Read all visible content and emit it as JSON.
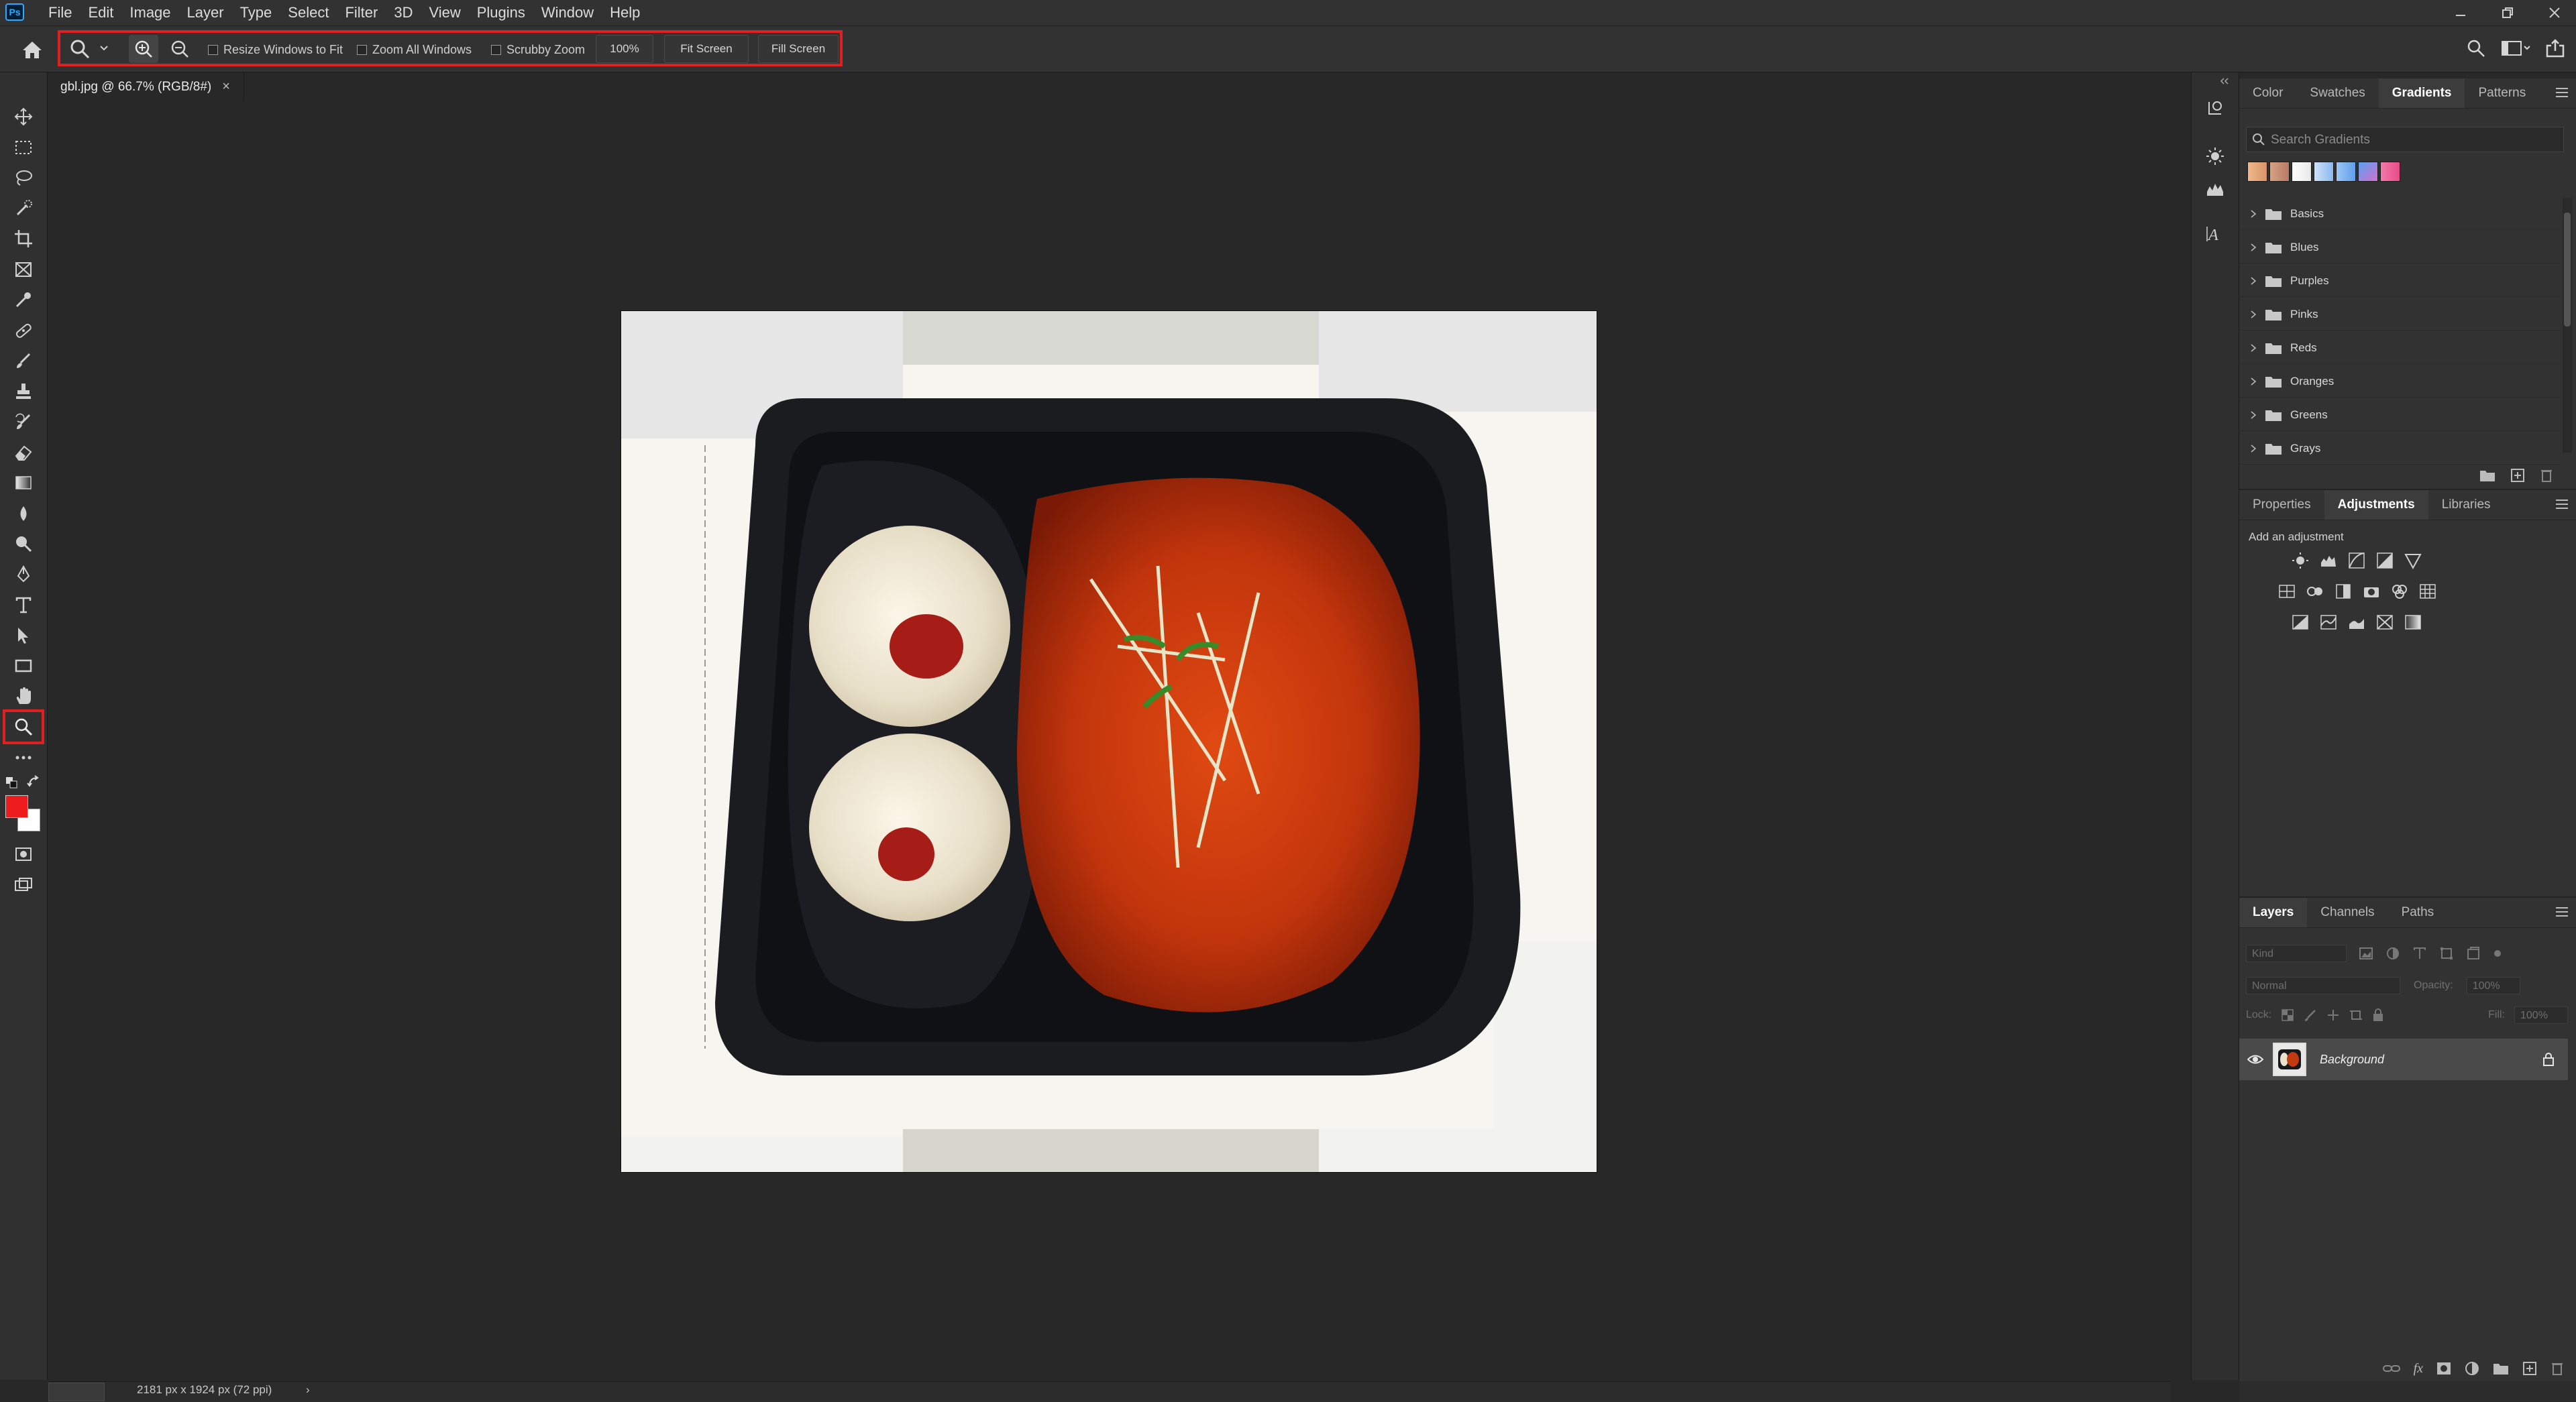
{
  "app": {
    "logo_text": "Ps"
  },
  "menu": [
    "File",
    "Edit",
    "Image",
    "Layer",
    "Type",
    "Select",
    "Filter",
    "3D",
    "View",
    "Plugins",
    "Window",
    "Help"
  ],
  "options_bar": {
    "resize_windows_label": "Resize Windows to Fit",
    "zoom_all_windows_label": "Zoom All Windows",
    "scrubby_zoom_label": "Scrubby Zoom",
    "zoom_100_label": "100%",
    "fit_screen_label": "Fit Screen",
    "fill_screen_label": "Fill Screen"
  },
  "document": {
    "tab_label": "gbl.jpg @ 66.7% (RGB/8#)",
    "close_glyph": "×"
  },
  "gradients_panel": {
    "tabs": [
      "Color",
      "Swatches",
      "Gradients",
      "Patterns"
    ],
    "active_tab": "Gradients",
    "search_placeholder": "Search Gradients",
    "preset_colors": [
      "#e8a77a",
      "#d89a7a",
      "#ffffff",
      "#a9c9ee",
      "#7eb3f0",
      "#c07bd8",
      "#ee6aa0"
    ],
    "folders": [
      "Basics",
      "Blues",
      "Purples",
      "Pinks",
      "Reds",
      "Oranges",
      "Greens",
      "Grays"
    ]
  },
  "adjustments_panel": {
    "tabs": [
      "Properties",
      "Adjustments",
      "Libraries"
    ],
    "active_tab": "Adjustments",
    "hint": "Add an adjustment"
  },
  "layers_panel": {
    "tabs": [
      "Layers",
      "Channels",
      "Paths"
    ],
    "active_tab": "Layers",
    "filter_kind": "Kind",
    "blend_mode": "Normal",
    "opacity_label": "Opacity:",
    "opacity_value": "100%",
    "lock_label": "Lock:",
    "fill_label": "Fill:",
    "fill_value": "100%",
    "layer_name": "Background"
  },
  "status": {
    "doc_info": "2181 px x 1924 px (72 ppi)",
    "arrow": "›"
  },
  "colors": {
    "foreground": "#ee1c1c",
    "background": "#ffffff",
    "highlight": "#e02020"
  }
}
